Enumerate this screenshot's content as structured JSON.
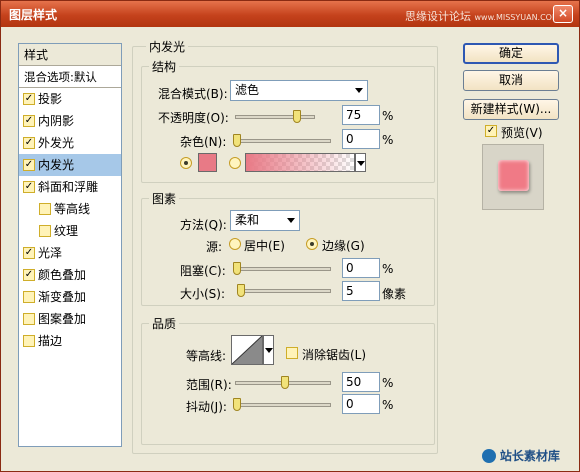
{
  "window": {
    "title": "图层样式",
    "watermark": "思缘设计论坛",
    "watermark_url": "www.MISSYUAN.COM",
    "close": "×"
  },
  "style_list": {
    "header": "样式",
    "blend_options": "混合选项:默认",
    "items": [
      {
        "label": "投影",
        "checked": true,
        "sub": false
      },
      {
        "label": "内阴影",
        "checked": true,
        "sub": false
      },
      {
        "label": "外发光",
        "checked": true,
        "sub": false
      },
      {
        "label": "内发光",
        "checked": true,
        "sub": false
      },
      {
        "label": "斜面和浮雕",
        "checked": true,
        "sub": false
      },
      {
        "label": "等高线",
        "checked": false,
        "sub": true
      },
      {
        "label": "纹理",
        "checked": false,
        "sub": true
      },
      {
        "label": "光泽",
        "checked": true,
        "sub": false
      },
      {
        "label": "颜色叠加",
        "checked": true,
        "sub": false
      },
      {
        "label": "渐变叠加",
        "checked": false,
        "sub": false
      },
      {
        "label": "图案叠加",
        "checked": false,
        "sub": false
      },
      {
        "label": "描边",
        "checked": false,
        "sub": false
      }
    ],
    "active_index": 3
  },
  "panel": {
    "title": "内发光",
    "structure": {
      "title": "结构",
      "blend_mode_label": "混合模式(B):",
      "blend_mode_value": "滤色",
      "opacity_label": "不透明度(O):",
      "opacity_value": "75",
      "opacity_fraction": 0.75,
      "noise_label": "杂色(N):",
      "noise_value": "0",
      "noise_fraction": 0,
      "percent": "%",
      "glow_color": "#e87a86"
    },
    "elements": {
      "title": "图素",
      "method_label": "方法(Q):",
      "method_value": "柔和",
      "source_label": "源:",
      "source_center": "居中(E)",
      "source_edge": "边缘(G)",
      "choke_label": "阻塞(C):",
      "choke_value": "0",
      "choke_fraction": 0,
      "size_label": "大小(S):",
      "size_value": "5",
      "size_fraction": 0.02,
      "size_unit": "像素",
      "percent": "%"
    },
    "quality": {
      "title": "品质",
      "contour_label": "等高线:",
      "antialias_label": "消除锯齿(L)",
      "range_label": "范围(R):",
      "range_value": "50",
      "range_fraction": 0.5,
      "jitter_label": "抖动(J):",
      "jitter_value": "0",
      "jitter_fraction": 0,
      "percent": "%"
    }
  },
  "buttons": {
    "ok": "确定",
    "cancel": "取消",
    "new_style": "新建样式(W)...",
    "preview_label": "预览(V)"
  },
  "preview_swatch_color": "#f07a86",
  "footer_logo": "站长素材库"
}
